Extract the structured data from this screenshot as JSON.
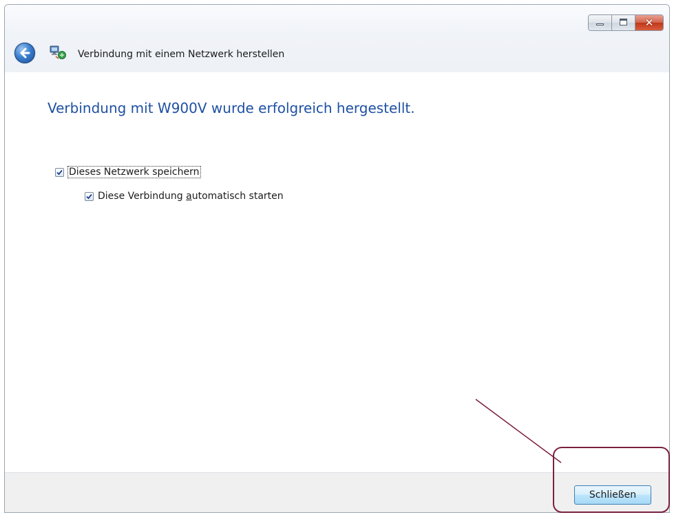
{
  "window": {
    "title": "Verbindung mit einem Netzwerk herstellen",
    "controls": [
      "minimize-icon",
      "maximize-icon",
      "close-icon"
    ]
  },
  "content": {
    "heading": "Verbindung mit W900V wurde erfolgreich hergestellt.",
    "options": [
      {
        "label_before": "Dieses Netzwerk speichern",
        "checked": true
      },
      {
        "label_before": "Diese Verbindung ",
        "label_underlined": "a",
        "label_after": "utomatisch starten",
        "checked": true
      }
    ]
  },
  "footer": {
    "close_label": "Schließen"
  },
  "colors": {
    "heading": "#1e50a2",
    "annotation": "#7b1f3f",
    "footer_bg": "#f0f0f0"
  }
}
